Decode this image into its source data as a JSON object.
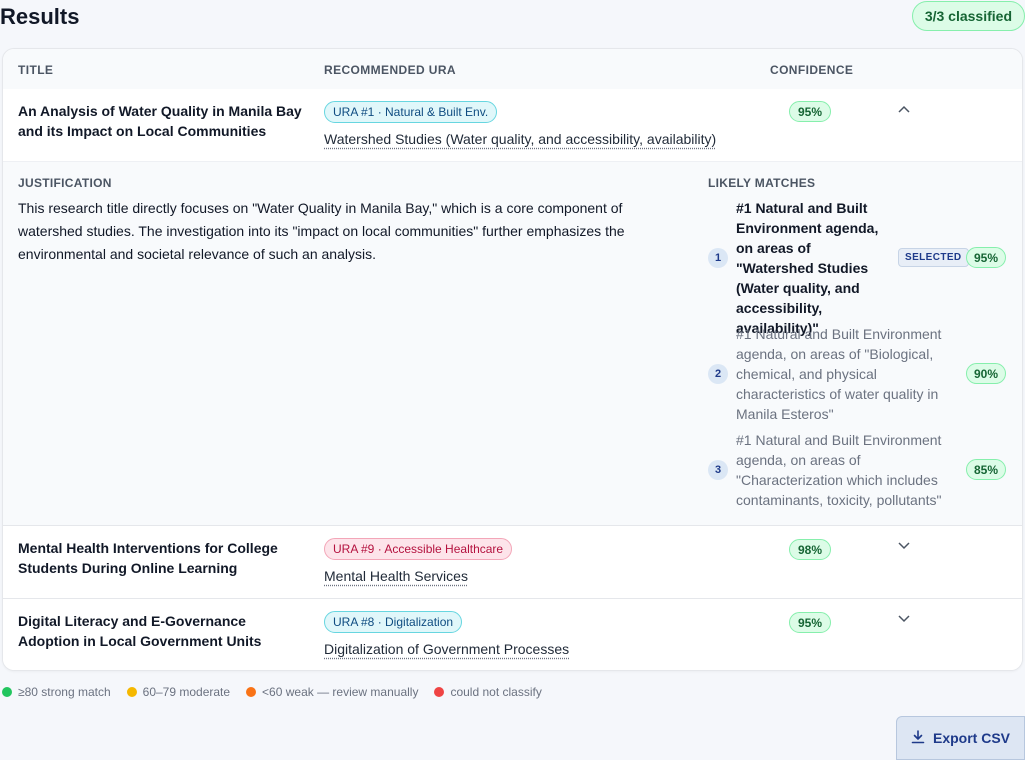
{
  "header": {
    "title": "Results",
    "count_badge": "3/3 classified"
  },
  "table": {
    "columns": {
      "title": "TITLE",
      "ura": "RECOMMENDED URA",
      "confidence": "CONFIDENCE"
    },
    "rows": [
      {
        "title": "An Analysis of Water Quality in Manila Bay and its Impact on Local Communities",
        "ura_tag": "URA #1 · Natural & Built Env.",
        "ura_sub": "Watershed Studies (Water quality, and accessibility, availability)",
        "confidence": "95%",
        "expanded": true
      },
      {
        "title": "Mental Health Interventions for College Students During Online Learning",
        "ura_tag": "URA #9 · Accessible Healthcare",
        "ura_sub": "Mental Health Services",
        "confidence": "98%",
        "expanded": false
      },
      {
        "title": "Digital Literacy and E-Governance Adoption in Local Government Units",
        "ura_tag": "URA #8 · Digitalization",
        "ura_sub": "Digitalization of Government Processes",
        "confidence": "95%",
        "expanded": false
      }
    ]
  },
  "detail": {
    "justification_label": "JUSTIFICATION",
    "justification_text": "This research title directly focuses on \"Water Quality in Manila Bay,\" which is a core component of watershed studies. The investigation into its \"impact on local communities\" further emphasizes the environmental and societal relevance of such an analysis.",
    "matches_label": "LIKELY MATCHES",
    "matches": [
      {
        "num": "1",
        "text": "#1 Natural and Built Environment agenda, on areas of \"Watershed Studies (Water quality, and accessibility, availability)\"",
        "badge": "SELECTED",
        "pct": "95%"
      },
      {
        "num": "2",
        "text": "#1 Natural and Built Environment agenda, on areas of \"Biological, chemical, and physical characteristics of water quality in Manila Esteros\"",
        "pct": "90%"
      },
      {
        "num": "3",
        "text": "#1 Natural and Built Environment agenda, on areas of \"Characterization which includes contaminants, toxicity, pollutants\"",
        "pct": "85%"
      }
    ]
  },
  "legend": [
    {
      "label": "≥80 strong match",
      "color": "#22c55e"
    },
    {
      "label": "60–79 moderate",
      "color": "#f5b800"
    },
    {
      "label": "<60 weak — review manually",
      "color": "#f97316"
    },
    {
      "label": "could not classify",
      "color": "#ef4444"
    }
  ],
  "export_label": "Export CSV",
  "colors": {
    "tag_green_bg": "#e0f7fa",
    "tag_green_border": "#67d6e0",
    "tag_green_text": "#0f4c81",
    "tag_red_bg": "#fde4ea",
    "tag_red_border": "#f3a6b8",
    "tag_red_text": "#b4123f"
  }
}
